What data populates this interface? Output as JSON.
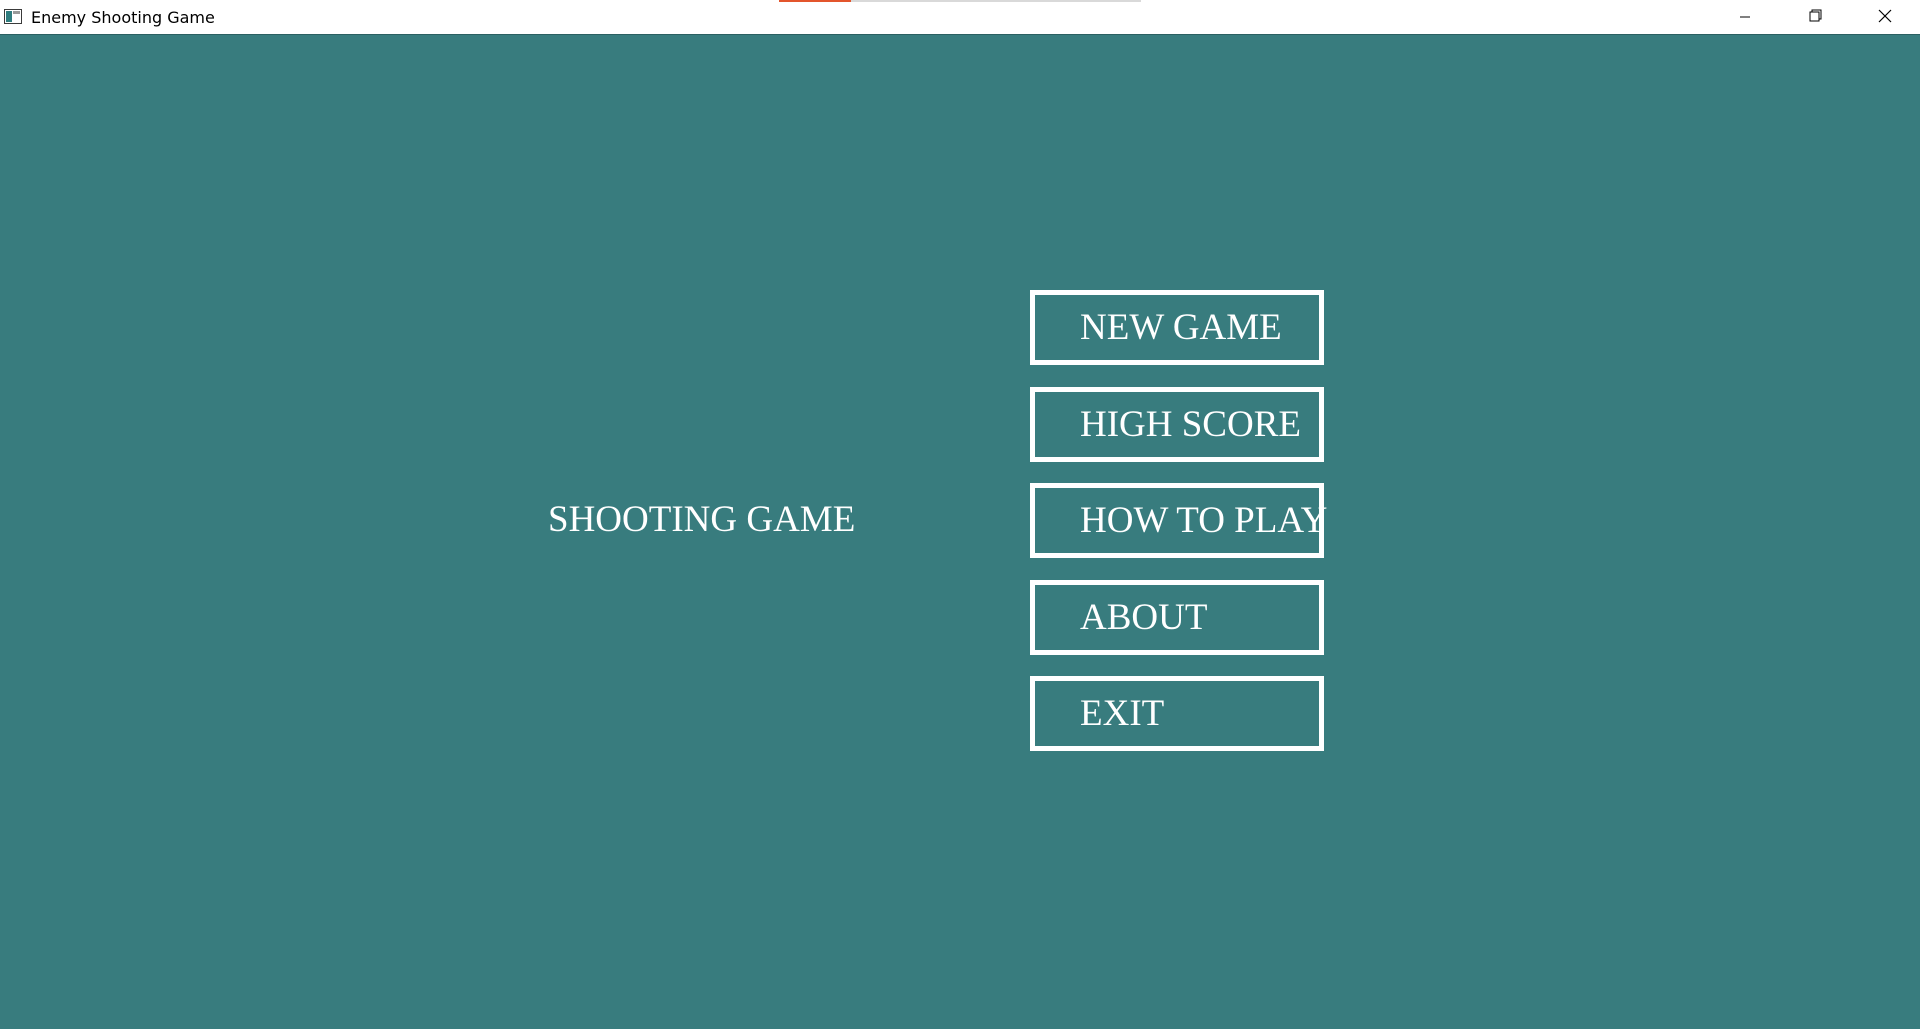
{
  "window": {
    "title": "Enemy Shooting Game",
    "background_color": "#387c7e",
    "controls": {
      "minimize_icon": "minimize-icon",
      "restore_icon": "restore-icon",
      "close_icon": "close-icon"
    }
  },
  "taskbar_progress": {
    "fraction": 0.2,
    "fill_color": "#e3552c"
  },
  "game": {
    "title": "SHOOTING GAME",
    "menu": [
      {
        "id": "new-game",
        "label": "NEW GAME"
      },
      {
        "id": "high-score",
        "label": "HIGH SCORE"
      },
      {
        "id": "how-to-play",
        "label": "HOW TO PLAY"
      },
      {
        "id": "about",
        "label": "ABOUT"
      },
      {
        "id": "exit",
        "label": "EXIT"
      }
    ]
  }
}
